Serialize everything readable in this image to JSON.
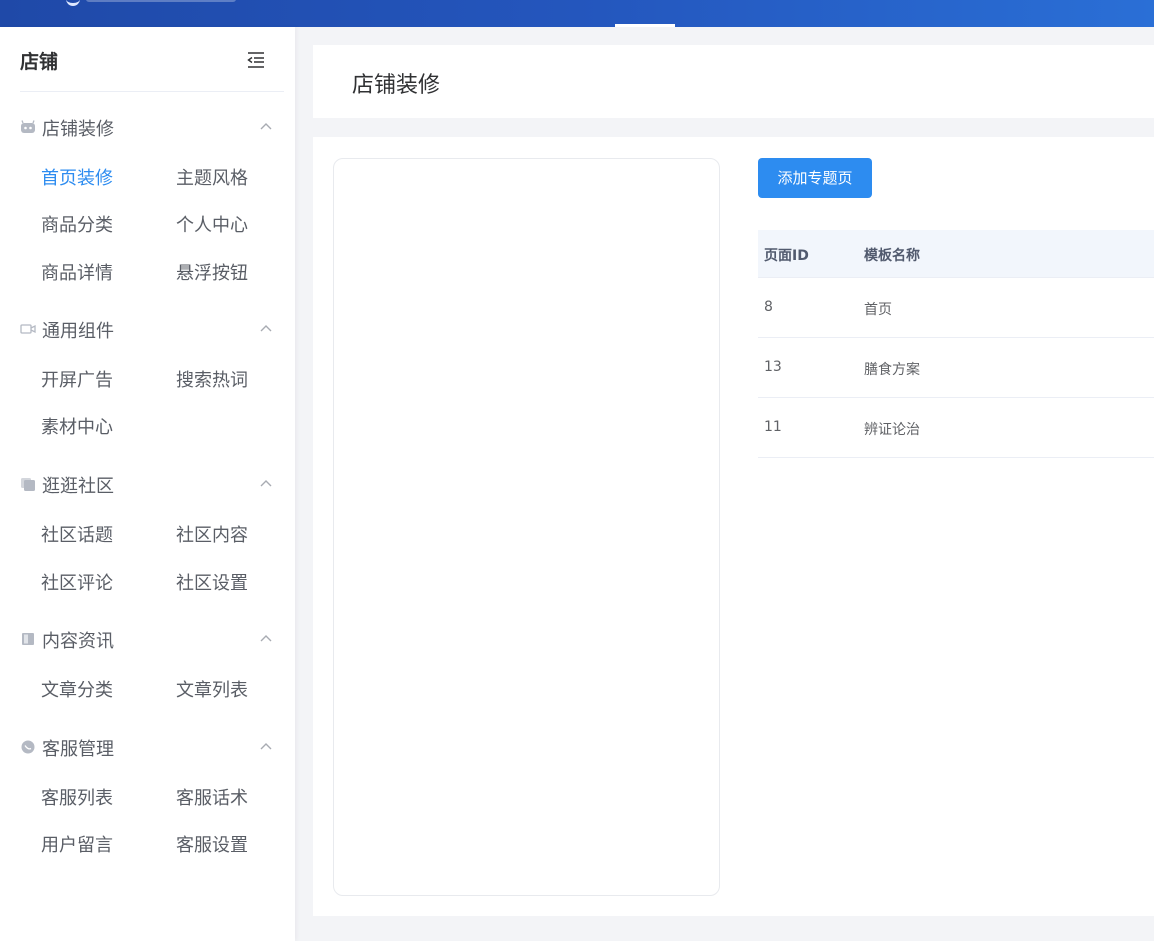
{
  "sidebar": {
    "title": "店铺",
    "groups": [
      {
        "label": "店铺装修",
        "icon": "bot-icon",
        "items": [
          "首页装修",
          "主题风格",
          "商品分类",
          "个人中心",
          "商品详情",
          "悬浮按钮"
        ],
        "active_item": "首页装修"
      },
      {
        "label": "通用组件",
        "icon": "video-icon",
        "items": [
          "开屏广告",
          "搜索热词",
          "素材中心"
        ]
      },
      {
        "label": "逛逛社区",
        "icon": "copy-icon",
        "items": [
          "社区话题",
          "社区内容",
          "社区评论",
          "社区设置"
        ]
      },
      {
        "label": "内容资讯",
        "icon": "book-icon",
        "items": [
          "文章分类",
          "文章列表"
        ]
      },
      {
        "label": "客服管理",
        "icon": "chat-icon",
        "items": [
          "客服列表",
          "客服话术",
          "用户留言",
          "客服设置"
        ]
      }
    ]
  },
  "main": {
    "title": "店铺装修",
    "add_button": "添加专题页",
    "table": {
      "headers": [
        "页面ID",
        "模板名称"
      ],
      "rows": [
        [
          "8",
          "首页"
        ],
        [
          "13",
          "膳食方案"
        ],
        [
          "11",
          "辨证论治"
        ]
      ]
    }
  },
  "colors": {
    "accent": "#2d8cf0",
    "header_from": "#1f49a8",
    "header_to": "#2a6fd6"
  }
}
